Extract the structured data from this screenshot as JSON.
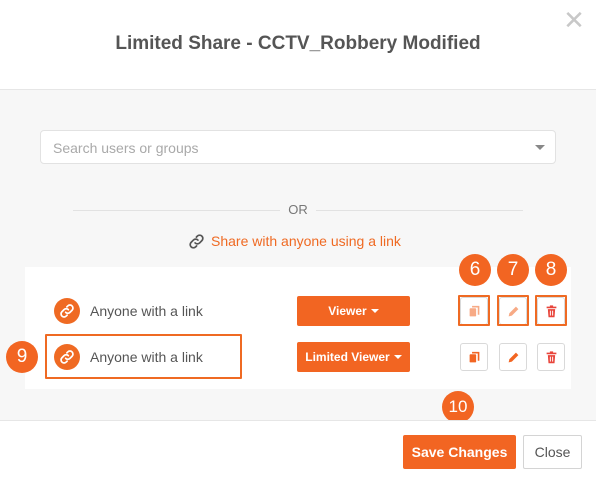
{
  "dialog": {
    "title": "Limited Share - CCTV_Robbery Modified",
    "close_symbol": "✕"
  },
  "search": {
    "placeholder": "Search users or groups",
    "value": ""
  },
  "divider": {
    "or_label": "OR"
  },
  "share_link": {
    "label": "Share with anyone using a link",
    "icon": "link-icon"
  },
  "share_rows": [
    {
      "label": "Anyone with a link",
      "role": "Viewer",
      "icon": "link-icon"
    },
    {
      "label": "Anyone with a link",
      "role": "Limited Viewer",
      "icon": "link-icon"
    }
  ],
  "row_actions": [
    {
      "name": "copy",
      "icon": "copy-icon"
    },
    {
      "name": "edit",
      "icon": "pencil-icon"
    },
    {
      "name": "delete",
      "icon": "trash-icon"
    }
  ],
  "callouts": [
    "6",
    "7",
    "8",
    "9",
    "10"
  ],
  "footer": {
    "save_label": "Save Changes",
    "close_label": "Close"
  },
  "colors": {
    "accent": "#f26522",
    "link": "#ef6a23",
    "body_bg": "#f7f7f7"
  }
}
